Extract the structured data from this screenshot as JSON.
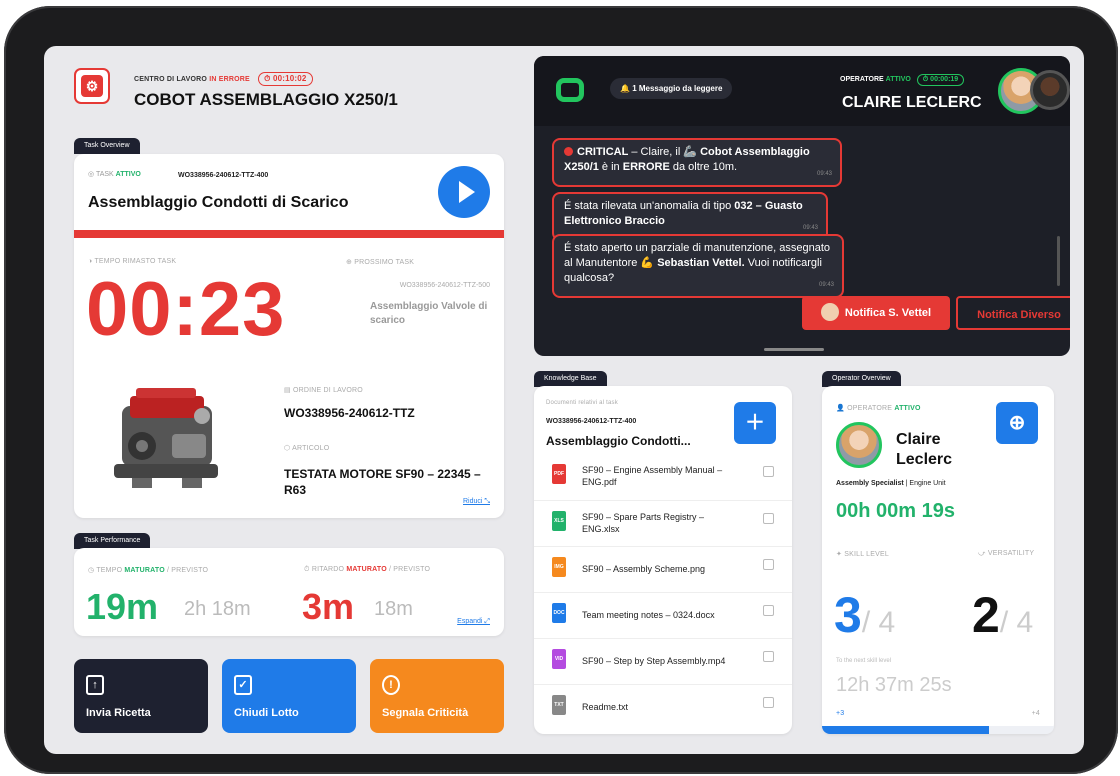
{
  "header": {
    "workcenter_label": "CENTRO DI LAVORO",
    "workcenter_state": "IN ERRORE",
    "error_timer": "⏱ 00:10:02",
    "title": "COBOT ASSEMBLAGGIO X250/1"
  },
  "task_overview": {
    "tab": "Task Overview",
    "task_label": "TASK",
    "task_state": "ATTIVO",
    "task_code": "WO338956-240612-TTZ-400",
    "task_name": "Assemblaggio Condotti di Scarico",
    "remaining_label": "TEMPO RIMASTO TASK",
    "remaining_time": "00:23",
    "next_label": "PROSSIMO TASK",
    "next_code": "WO338956-240612-TTZ-500",
    "next_name": "Assemblaggio Valvole di scarico",
    "order_label": "ORDINE DI LAVORO",
    "order_value": "WO338956-240612-TTZ",
    "article_label": "ARTICOLO",
    "article_value": "TESTATA MOTORE SF90 – 22345 – R63",
    "reduce_link": "Riduci ⤡"
  },
  "task_performance": {
    "tab": "Task Performance",
    "time_label": "TEMPO",
    "time_state": "MATURATO",
    "time_suffix": "/ PREVISTO",
    "time_actual": "19m",
    "time_planned": "2h 18m",
    "delay_label": "RITARDO",
    "delay_state": "MATURATO",
    "delay_suffix": "/ PREVISTO",
    "delay_actual": "3m",
    "delay_planned": "18m",
    "expand_link": "Espandi ⤢"
  },
  "actions": [
    {
      "label": "Invia Ricetta",
      "icon": "file-upload-icon",
      "color": "#1e2130"
    },
    {
      "label": "Chiudi Lotto",
      "icon": "clipboard-check-icon",
      "color": "#1f7be8"
    },
    {
      "label": "Segnala Criticità",
      "icon": "alert-octagon-icon",
      "color": "#f5891e"
    }
  ],
  "chat": {
    "unread": "1 Messaggio da leggere",
    "operator_label": "OPERATORE",
    "operator_state": "ATTIVO",
    "operator_timer": "⏱ 00:00:19",
    "operator_name": "CLAIRE LECLERC",
    "messages": [
      {
        "html": "<span class=\"dot\"></span><b>CRITICAL</b> – Claire, il 🦾 <b>Cobot Assemblaggio X250/1</b> è in <b>ERRORE</b> da oltre 10m.",
        "time": "09:43"
      },
      {
        "html": "É stata rilevata un'anomalia di tipo <b>032 – Guasto Elettronico Braccio</b>",
        "time": "09:43"
      },
      {
        "html": "É stato aperto un parziale di manutenzione, assegnato al Manutentore 💪 <b>Sebastian Vettel.</b> Vuoi notificargli qualcosa?",
        "time": "09:43"
      }
    ],
    "notify_primary": "Notifica S. Vettel",
    "notify_other": "Notifica Diverso"
  },
  "knowledge_base": {
    "tab": "Knowledge Base",
    "subtitle": "Documenti relativi al task",
    "code": "WO338956-240612-TTZ-400",
    "title": "Assemblaggio Condotti...",
    "files": [
      {
        "name": "SF90 – Engine Assembly Manual – ENG.pdf",
        "type": "PDF",
        "color": "#e53935"
      },
      {
        "name": "SF90 – Spare Parts Registry – ENG.xlsx",
        "type": "XLS",
        "color": "#22b26b"
      },
      {
        "name": "SF90 – Assembly Scheme.png",
        "type": "IMG",
        "color": "#f5891e"
      },
      {
        "name": "Team meeting notes – 0324.docx",
        "type": "DOC",
        "color": "#1f7be8"
      },
      {
        "name": "SF90 – Step by Step Assembly.mp4",
        "type": "VID",
        "color": "#b44be0"
      },
      {
        "name": "Readme.txt",
        "type": "TXT",
        "color": "#888888"
      }
    ]
  },
  "operator_overview": {
    "tab": "Operator Overview",
    "label": "OPERATORE",
    "state": "ATTIVO",
    "first_name": "Claire",
    "last_name": "Leclerc",
    "role": "Assembly Specialist",
    "unit": "Engine Unit",
    "elapsed": "00h 00m 19s",
    "skill_label": "SKILL LEVEL",
    "skill_value": "3",
    "skill_max": "/ 4",
    "versatility_label": "VERSATILITY",
    "versatility_value": "2",
    "versatility_max": "/ 4",
    "next_level_label": "To the next skill level",
    "next_level_time": "12h 37m 25s",
    "level_from": "+3",
    "level_to": "+4",
    "progress": 0.72
  }
}
